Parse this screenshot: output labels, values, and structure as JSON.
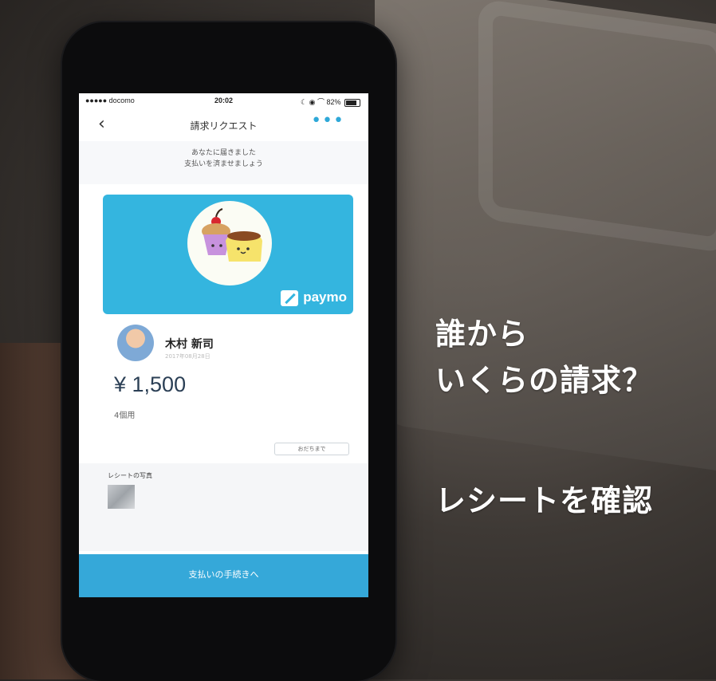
{
  "status_bar": {
    "carrier": "●●●●● docomo",
    "time": "20:02",
    "battery": "82%",
    "battery_level": 0.82
  },
  "nav": {
    "back_icon": "chevron-left-icon",
    "title": "請求リクエスト",
    "more_icon": "more-dots-icon",
    "more_glyph": "•••"
  },
  "notice": {
    "line1": "あなたに届きました",
    "line2": "支払いを済ませましょう"
  },
  "card": {
    "brand": "paymo",
    "illustration": "cupcake-pudding-illustration",
    "color": "#34b5df"
  },
  "request": {
    "sender_name": "木村 新司",
    "date": "2017年08月28日",
    "amount": "¥ 1,500",
    "memo": "4個用",
    "send_button": "おだちまで"
  },
  "receipt": {
    "label": "レシートの写真"
  },
  "pay_button": "支払いの手続きへ",
  "captions": {
    "line1": "誰から",
    "line2": "いくらの請求？",
    "line3": "レシートを確認"
  }
}
